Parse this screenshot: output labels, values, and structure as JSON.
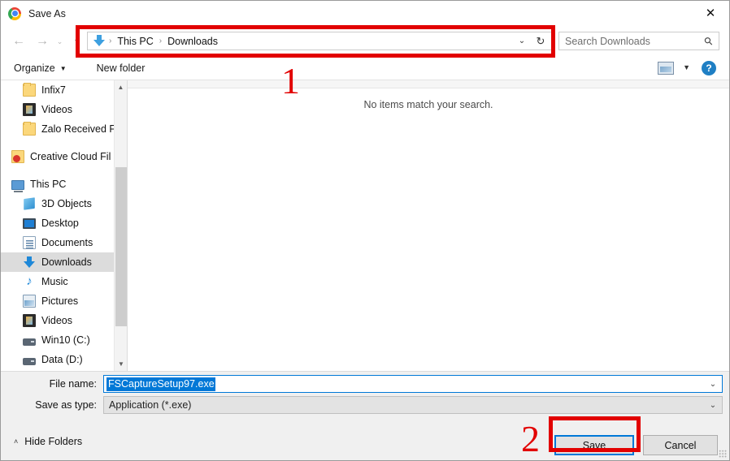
{
  "window": {
    "title": "Save As",
    "app_icon": "chrome-icon",
    "close_label": "✕"
  },
  "nav": {
    "back_icon": "←",
    "forward_icon": "→",
    "recent_icon": "⌄",
    "up_icon": "↑"
  },
  "address": {
    "drive_icon": "download-arrow-icon",
    "crumbs": [
      "This PC",
      "Downloads"
    ],
    "separator": "›",
    "dropdown_icon": "⌄",
    "refresh_icon": "↻"
  },
  "search": {
    "placeholder": "Search Downloads",
    "value": "",
    "icon": "search-icon",
    "icon_glyph": "⚲"
  },
  "toolbar": {
    "organize_label": "Organize",
    "organize_caret": "▼",
    "new_folder_label": "New folder",
    "view_caret": "▼",
    "help_label": "?"
  },
  "sidebar": {
    "items": [
      {
        "label": "Infix7",
        "icon": "folder-icon",
        "icon_class": "ico-folder",
        "indent": 27,
        "selected": false
      },
      {
        "label": "Videos",
        "icon": "videos-icon",
        "icon_class": "ico-video",
        "indent": 27,
        "selected": false
      },
      {
        "label": "Zalo Received Fi",
        "icon": "folder-icon",
        "icon_class": "ico-folder",
        "indent": 27,
        "selected": false
      },
      {
        "label": "",
        "icon": "spacer",
        "icon_class": "",
        "indent": 0,
        "selected": false
      },
      {
        "label": "Creative Cloud Fil",
        "icon": "creative-cloud-icon",
        "icon_class": "ico-cc",
        "indent": 13,
        "selected": false
      },
      {
        "label": "",
        "icon": "spacer",
        "icon_class": "",
        "indent": 0,
        "selected": false
      },
      {
        "label": "This PC",
        "icon": "this-pc-icon",
        "icon_class": "ico-pc",
        "indent": 13,
        "selected": false
      },
      {
        "label": "3D Objects",
        "icon": "3d-objects-icon",
        "icon_class": "ico-3d",
        "indent": 27,
        "selected": false
      },
      {
        "label": "Desktop",
        "icon": "desktop-icon",
        "icon_class": "ico-desktop",
        "indent": 27,
        "selected": false
      },
      {
        "label": "Documents",
        "icon": "documents-icon",
        "icon_class": "ico-doc",
        "indent": 27,
        "selected": false
      },
      {
        "label": "Downloads",
        "icon": "downloads-icon",
        "icon_class": "ico-dl",
        "indent": 27,
        "selected": true
      },
      {
        "label": "Music",
        "icon": "music-icon",
        "icon_class": "ico-music",
        "indent": 27,
        "selected": false,
        "glyph": "♪"
      },
      {
        "label": "Pictures",
        "icon": "pictures-icon",
        "icon_class": "ico-pic",
        "indent": 27,
        "selected": false
      },
      {
        "label": "Videos",
        "icon": "videos-icon",
        "icon_class": "ico-video",
        "indent": 27,
        "selected": false
      },
      {
        "label": "Win10 (C:)",
        "icon": "drive-icon",
        "icon_class": "ico-drive",
        "indent": 27,
        "selected": false
      },
      {
        "label": "Data (D:)",
        "icon": "drive-icon",
        "icon_class": "ico-drive",
        "indent": 27,
        "selected": false
      }
    ],
    "scroll_up_icon": "▲",
    "scroll_down_icon": "▼"
  },
  "filelist": {
    "empty_message": "No items match your search."
  },
  "form": {
    "filename_label": "File name:",
    "filename_value": "FSCaptureSetup97.exe",
    "filename_selected": true,
    "savetype_label": "Save as type:",
    "savetype_value": "Application (*.exe)",
    "caret_icon": "⌄"
  },
  "footer": {
    "hide_folders_label": "Hide Folders",
    "hide_folders_caret": "˄",
    "save_label": "Save",
    "cancel_label": "Cancel"
  },
  "annotations": {
    "step_1": "1",
    "step_2": "2",
    "color": "#e20000"
  }
}
